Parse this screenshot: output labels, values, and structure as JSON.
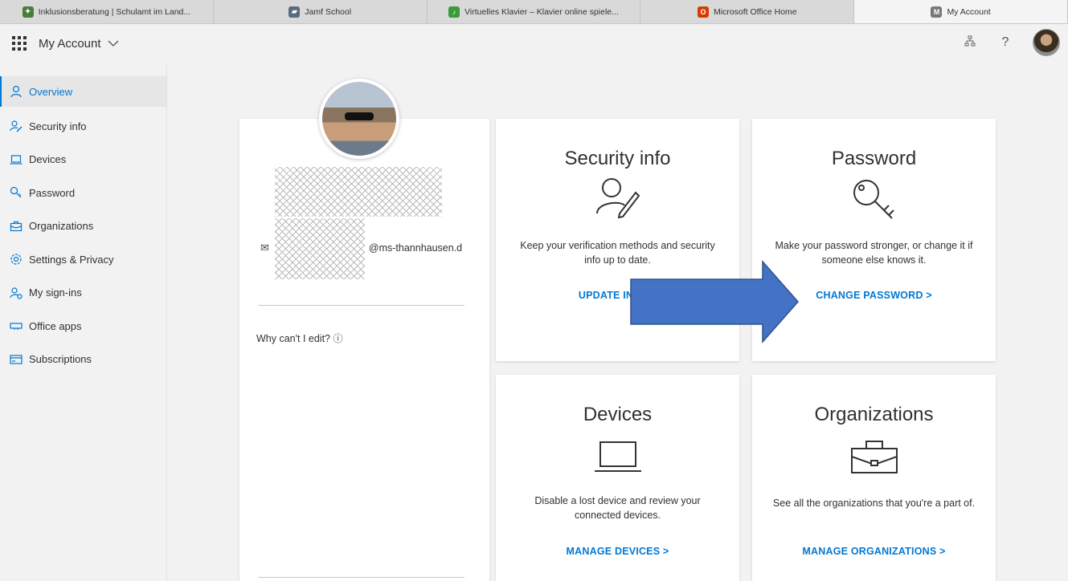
{
  "browser": {
    "tabs": [
      {
        "label": "Inklusionsberatung | Schulamt im Land...",
        "favicon_color": "#4a7c3a"
      },
      {
        "label": "Jamf School",
        "favicon_color": "#5a6b7d"
      },
      {
        "label": "Virtuelles Klavier – Klavier online spiele...",
        "favicon_color": "#3a9b3a"
      },
      {
        "label": "Microsoft Office Home",
        "favicon_color": "#d83b01"
      },
      {
        "label": "My Account",
        "favicon_color": "#777777"
      }
    ],
    "active_tab": 4
  },
  "header": {
    "title": "My Account",
    "icons": [
      "waffle-icon",
      "chevron-down-icon",
      "org-chart-icon",
      "help-icon"
    ]
  },
  "sidebar": {
    "items": [
      {
        "label": "Overview",
        "icon": "person-icon"
      },
      {
        "label": "Security info",
        "icon": "person-edit-icon"
      },
      {
        "label": "Devices",
        "icon": "laptop-icon"
      },
      {
        "label": "Password",
        "icon": "key-icon"
      },
      {
        "label": "Organizations",
        "icon": "briefcase-icon"
      },
      {
        "label": "Settings & Privacy",
        "icon": "gear-icon"
      },
      {
        "label": "My sign-ins",
        "icon": "person-signin-icon"
      },
      {
        "label": "Office apps",
        "icon": "apps-icon"
      },
      {
        "label": "Subscriptions",
        "icon": "card-icon"
      }
    ],
    "active": 0
  },
  "profile": {
    "email_suffix": "@ms-thannhausen.d",
    "why_edit": "Why can't I edit?"
  },
  "tiles": {
    "security": {
      "title": "Security info",
      "desc": "Keep your verification methods and security info up to date.",
      "link": "UPDATE INFO >"
    },
    "password": {
      "title": "Password",
      "desc": "Make your password stronger, or change it if someone else knows it.",
      "link": "CHANGE PASSWORD >"
    },
    "devices": {
      "title": "Devices",
      "desc": "Disable a lost device and review your connected devices.",
      "link": "MANAGE DEVICES >"
    },
    "organizations": {
      "title": "Organizations",
      "desc": "See all the organizations that you're a part of.",
      "link": "MANAGE ORGANIZATIONS >"
    }
  },
  "colors": {
    "accent": "#0078d4",
    "arrow_fill": "#4472c4"
  }
}
